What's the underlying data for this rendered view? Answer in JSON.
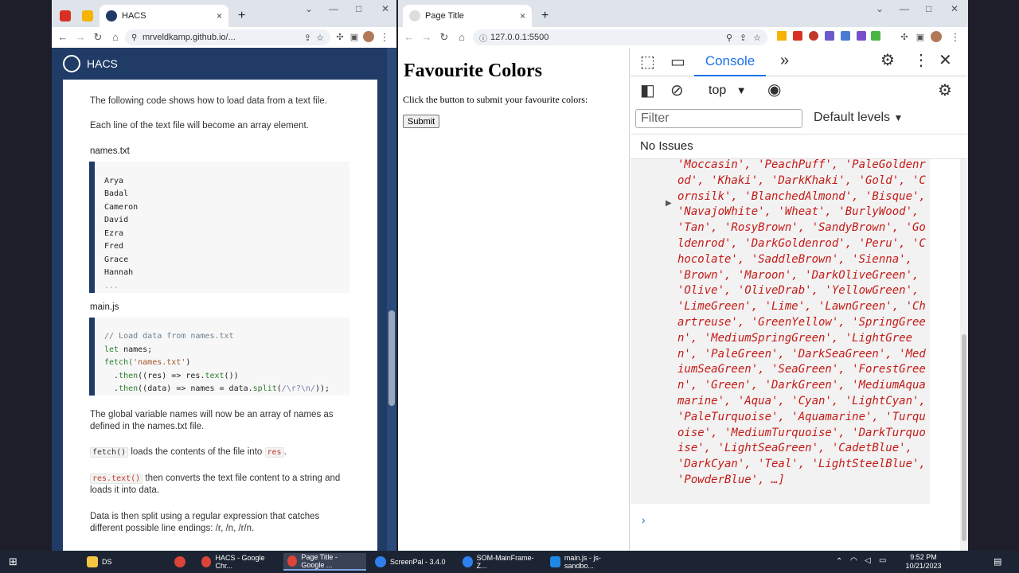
{
  "left_window": {
    "tabs": [
      {
        "label": ""
      },
      {
        "label": ""
      },
      {
        "label": "HACS"
      }
    ],
    "new_tab": "+",
    "close_tab": "×",
    "window_controls": {
      "minimize": "—",
      "maximize": "□",
      "close": "✕",
      "chevron": "⌄"
    },
    "address": "mrveldkamp.github.io/...",
    "hacs_title": "HACS",
    "doc": {
      "p1": "The following code shows how to load data from a text file.",
      "p2": "Each line of the text file will become an array element.",
      "file1": "names.txt",
      "names": [
        "Arya",
        "Badal",
        "Cameron",
        "David",
        "Ezra",
        "Fred",
        "Grace",
        "Hannah",
        "..."
      ],
      "file2": "main.js",
      "code": {
        "comment": "// Load data from names.txt",
        "l2_kw": "let",
        "l2_rest": " names;",
        "l3_fn": "fetch(",
        "l3_str": "'names.txt'",
        "l3_end": ")",
        "l4_a": "  .",
        "l4_fn": "then",
        "l4_b": "((res) => res.",
        "l4_fn2": "text",
        "l4_c": "())",
        "l5_a": "  .",
        "l5_fn": "then",
        "l5_b": "((data) => names = data.",
        "l5_fn2": "split",
        "l5_c": "(",
        "l5_re": "/\\r?\\n/",
        "l5_d": "));"
      },
      "p3": "The global variable names will now be an array of names as defined in the names.txt file.",
      "p4_code": "fetch()",
      "p4_text": " loads the contents of the file into ",
      "p4_code2": "res",
      "p4_end": ".",
      "p5_code": "res.text()",
      "p5_text": " then converts the text file content to a string and loads it into data.",
      "p6": "Data is then split using a regular expression that catches different possible line endings: /r, /n, /r/n."
    }
  },
  "right_window": {
    "tab": "Page Title",
    "close_tab": "×",
    "new_tab": "+",
    "window_controls": {
      "minimize": "—",
      "maximize": "□",
      "close": "✕",
      "chevron": "⌄"
    },
    "address": "127.0.0.1:5500",
    "page": {
      "heading": "Favourite Colors",
      "instruction": "Click the button to submit your favourite colors:",
      "submit": "Submit"
    },
    "devtools": {
      "tab_console": "Console",
      "more_tabs": "»",
      "context": "top",
      "filter_placeholder": "Filter",
      "levels": "Default levels",
      "issues": "No Issues",
      "expand_arrow": "▶",
      "prompt": "›",
      "output": "'Moccasin', 'PeachPuff', 'PaleGoldenrod', 'Khaki', 'DarkKhaki', 'Gold', 'Cornsilk', 'BlanchedAlmond', 'Bisque', 'NavajoWhite', 'Wheat', 'BurlyWood', 'Tan', 'RosyBrown', 'SandyBrown', 'Goldenrod', 'DarkGoldenrod', 'Peru', 'Chocolate', 'SaddleBrown', 'Sienna', 'Brown', 'Maroon', 'DarkOliveGreen', 'Olive', 'OliveDrab', 'YellowGreen', 'LimeGreen', 'Lime', 'LawnGreen', 'Chartreuse', 'GreenYellow', 'SpringGreen', 'MediumSpringGreen', 'LightGreen', 'PaleGreen', 'DarkSeaGreen', 'MediumSeaGreen', 'SeaGreen', 'ForestGreen', 'Green', 'DarkGreen', 'MediumAquamarine', 'Aqua', 'Cyan', 'LightCyan', 'PaleTurquoise', 'Aquamarine', 'Turquoise', 'MediumTurquoise', 'DarkTurquoise', 'LightSeaGreen', 'CadetBlue', 'DarkCyan', 'Teal', 'LightSteelBlue', 'PowderBlue', …]"
    }
  },
  "taskbar": {
    "items": [
      {
        "label": "DS"
      },
      {
        "label": ""
      },
      {
        "label": "HACS - Google Chr..."
      },
      {
        "label": "Page Title - Google ..."
      },
      {
        "label": "ScreenPal - 3.4.0"
      },
      {
        "label": "SOM-MainFrame-Z..."
      },
      {
        "label": "main.js - js-sandbo..."
      }
    ],
    "time": "9:52 PM",
    "date": "10/21/2023"
  },
  "colors": {
    "hacs_blue": "#1f3b66",
    "console_red": "#c41a16",
    "link_blue": "#1a73e8"
  }
}
